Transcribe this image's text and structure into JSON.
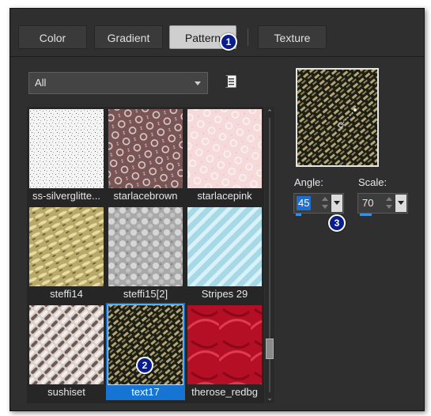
{
  "tabs": [
    {
      "label": "Color"
    },
    {
      "label": "Gradient"
    },
    {
      "label": "Pattern"
    },
    {
      "label": "Texture"
    }
  ],
  "active_tab": "Pattern",
  "category_select": {
    "value": "All"
  },
  "patterns": [
    {
      "name": "ss-silverglitte..."
    },
    {
      "name": "starlacebrown"
    },
    {
      "name": "starlacepink"
    },
    {
      "name": "steffi14"
    },
    {
      "name": "steffi15[2]"
    },
    {
      "name": "Stripes 29"
    },
    {
      "name": "sushiset"
    },
    {
      "name": "text17"
    },
    {
      "name": "therose_redbg"
    }
  ],
  "selected_pattern": "text17",
  "angle": {
    "label": "Angle:",
    "value": "45",
    "level": 0.12
  },
  "scale": {
    "label": "Scale:",
    "value": "70",
    "level": 0.25
  },
  "callouts": [
    "1",
    "2",
    "3"
  ],
  "colors": {
    "accent": "#1574d4",
    "badge": "#0a1d8c",
    "panel": "#2f2f2f"
  }
}
